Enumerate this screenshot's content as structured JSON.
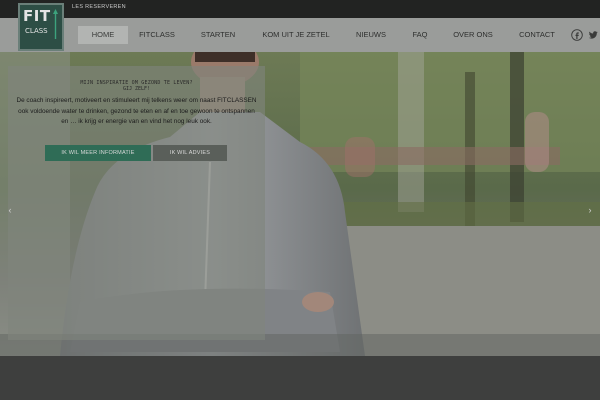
{
  "topbar": {
    "reserve_link": "LES RESERVEREN"
  },
  "logo": {
    "line1": "FIT",
    "line2": "CLASS"
  },
  "nav": {
    "items": [
      {
        "label": "HOME",
        "active": true
      },
      {
        "label": "FITCLASS",
        "active": false
      },
      {
        "label": "STARTEN",
        "active": false
      },
      {
        "label": "KOM UIT JE ZETEL",
        "active": false
      },
      {
        "label": "NIEUWS",
        "active": false
      },
      {
        "label": "FAQ",
        "active": false
      },
      {
        "label": "OVER ONS",
        "active": false
      },
      {
        "label": "CONTACT",
        "active": false
      }
    ],
    "social": [
      "facebook-icon",
      "twitter-icon"
    ]
  },
  "hero": {
    "question_line1": "MIJN INSPIRATIE OM GEZOND TE LEVEN?",
    "question_line2": "GIJ ZELF!",
    "body": "De coach inspireert, motiveert en stimuleert mij telkens weer om naast FITCLASSEN ook voldoende water te drinken, gezond te eten en af en toe gewoon te ontspannen en … ik krijg er energie van en vind het nog leuk ook.",
    "button_info": "IK WIL MEER INFORMATIE",
    "button_advice": "IK WIL ADVIES",
    "prev_arrow": "‹",
    "next_arrow": "›"
  },
  "colors": {
    "accent_green": "#2f6c56",
    "logo_bg": "#2d4e45",
    "nav_bg": "#9a9c9a",
    "topbar_bg": "#222322"
  }
}
